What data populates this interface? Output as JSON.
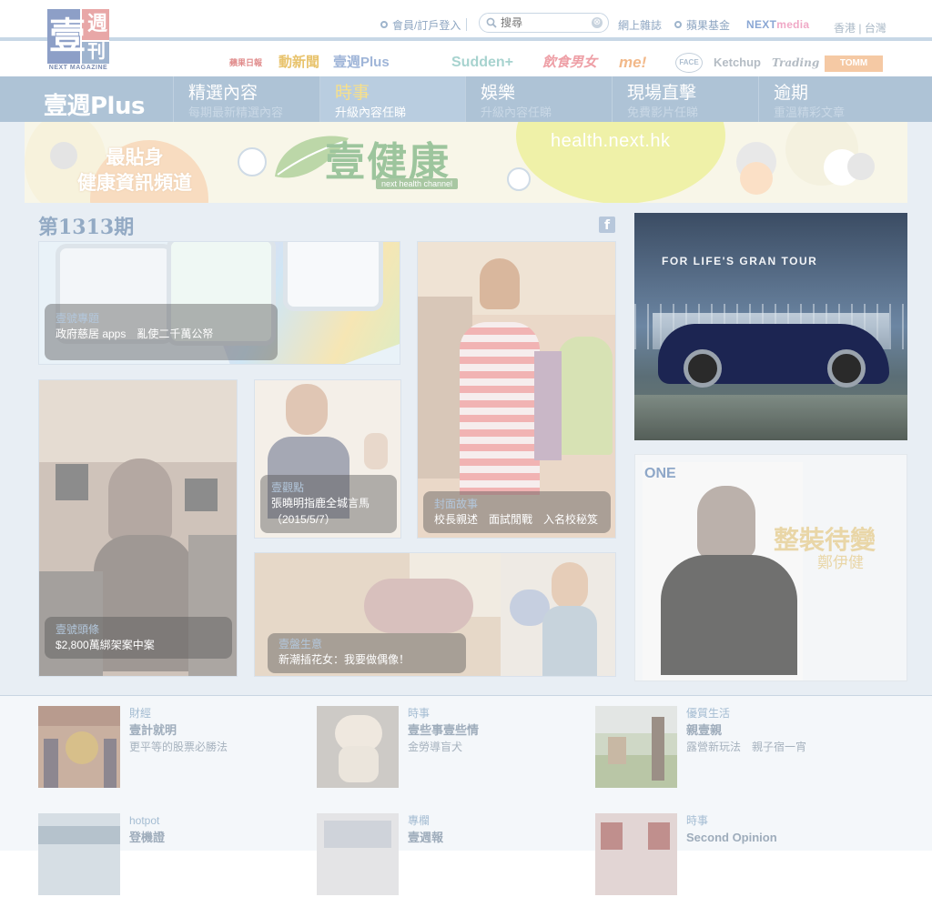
{
  "header": {
    "logo": {
      "big": "壹",
      "small1": "週",
      "small2": "刊",
      "caption": "NEXT MAGAZINE"
    },
    "member_login": "會員/訂戶登入",
    "search_placeholder": "搜尋",
    "search_clear": "⊗",
    "online_magazine": "網上雜誌",
    "apple_fund": "蘋果基金",
    "nextmedia": {
      "next": "NEXT",
      "media": "media"
    },
    "region_hk": "香港",
    "region_sep": "|",
    "region_tw": "台灣",
    "brands": [
      "蘋果日報",
      "動新聞",
      "壹週Plus",
      "Sudden+",
      "飲食男女",
      "me!",
      "FACE",
      "Ketchup",
      "Trading",
      "TOMM"
    ]
  },
  "mainnav": {
    "logo": "壹週Plus",
    "items": [
      {
        "title": "精選內容",
        "sub": "每期最新精選內容"
      },
      {
        "title": "時事",
        "sub": "升級內容任睇"
      },
      {
        "title": "娛樂",
        "sub": "升級內容任睇"
      },
      {
        "title": "現場直擊",
        "sub": "免費影片任睇"
      },
      {
        "title": "逾期",
        "sub": "重溫精彩文章"
      }
    ]
  },
  "banner": {
    "left_line1": "最貼身",
    "left_line2": "健康資訊頻道",
    "title": "壹健康",
    "subtitle": "next health channel",
    "url": "health.next.hk"
  },
  "issue": "第1313期",
  "facebook_icon": "f",
  "cards": [
    {
      "cat": "壹號專題",
      "title": "政府慈居 apps　亂使二千萬公帑"
    },
    {
      "cat": "封面故事",
      "title": "校長親述　面試閒戰　入名校秘笈"
    },
    {
      "cat": "壹號頭條",
      "title": "$2,800萬綁架案中案"
    },
    {
      "cat": "壹觀點",
      "title": "張曉明指鹿全城言馬（2015/5/7）"
    },
    {
      "cat": "壹盤生意",
      "title": "新潮插花女：我要做偶像！"
    }
  ],
  "ads": {
    "car_tagline": "FOR LIFE'S GRAN TOUR",
    "one_logo": "ONE",
    "one_title": "整裝待變",
    "one_name": "鄭伊健"
  },
  "bottom_items": [
    {
      "cat": "財經",
      "title": "壹計就明",
      "sub": "更平等的股票必勝法"
    },
    {
      "cat": "時事",
      "title": "壹些事壹些情",
      "sub": "金勞導盲犬"
    },
    {
      "cat": "優質生活",
      "title": "親壹親",
      "sub": "露營新玩法　親子宿一宵"
    },
    {
      "cat": "hotpot",
      "title": "登機證",
      "sub": ""
    },
    {
      "cat": "專欄",
      "title": "壹週報",
      "sub": ""
    },
    {
      "cat": "時事",
      "title": "Second Opinion",
      "sub": ""
    }
  ],
  "colors": {
    "nav_bg": "#aec3d6",
    "accent_active": "#f7e08a",
    "link": "#8ea6c2"
  }
}
